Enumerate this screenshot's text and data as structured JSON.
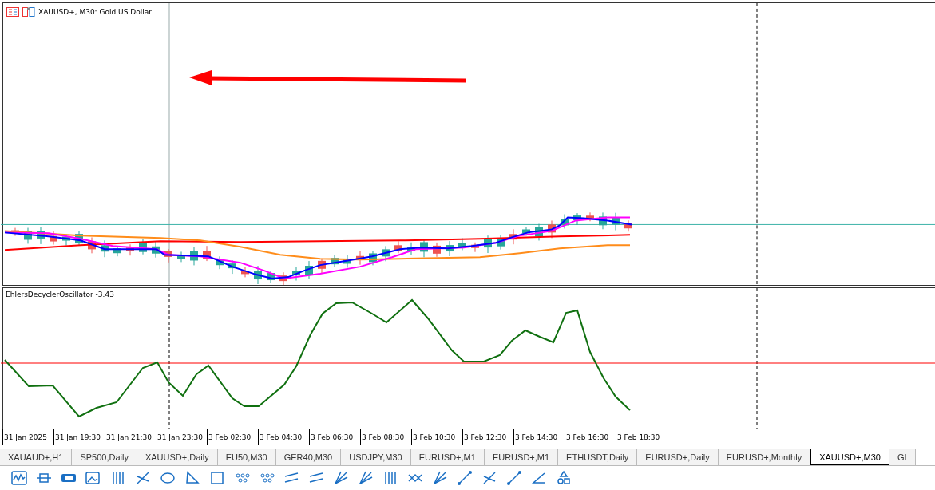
{
  "chart": {
    "title": "XAUUSD+, M30:  Gold US Dollar"
  },
  "indicator": {
    "label": "EhlersDecyclerOscillator -3.43"
  },
  "time_axis": [
    "31 Jan 2025",
    "31 Jan 19:30",
    "31 Jan 21:30",
    "31 Jan 23:30",
    "3 Feb 02:30",
    "3 Feb 04:30",
    "3 Feb 06:30",
    "3 Feb 08:30",
    "3 Feb 10:30",
    "3 Feb 12:30",
    "3 Feb 14:30",
    "3 Feb 16:30",
    "3 Feb 18:30"
  ],
  "tabs": [
    {
      "label": "XAUAUD+,H1",
      "selected": false
    },
    {
      "label": "SP500,Daily",
      "selected": false
    },
    {
      "label": "XAUUSD+,Daily",
      "selected": false
    },
    {
      "label": "EU50,M30",
      "selected": false
    },
    {
      "label": "GER40,M30",
      "selected": false
    },
    {
      "label": "USDJPY,M30",
      "selected": false
    },
    {
      "label": "EURUSD+,M1",
      "selected": false
    },
    {
      "label": "EURUSD+,M1",
      "selected": false
    },
    {
      "label": "ETHUSDT,Daily",
      "selected": false
    },
    {
      "label": "EURUSD+,Daily",
      "selected": false
    },
    {
      "label": "EURUSD+,Monthly",
      "selected": false
    },
    {
      "label": "XAUUSD+,M30",
      "selected": true
    },
    {
      "label": "GI",
      "selected": false
    }
  ]
}
